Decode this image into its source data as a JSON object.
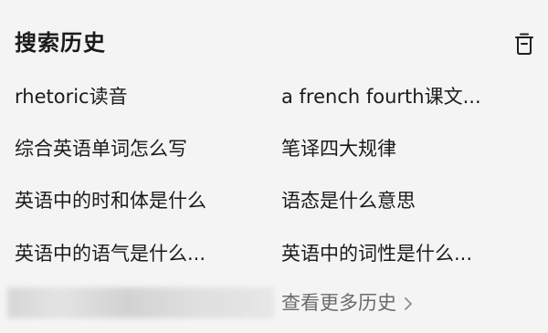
{
  "header": {
    "title": "搜索历史",
    "clear_icon": "trash-icon"
  },
  "history": {
    "items": [
      "rhetoric读音",
      "a french fourth课文...",
      "综合英语单词怎么写",
      "笔译四大规律",
      "英语中的时和体是什么",
      "语态是什么意思",
      "英语中的语气是什么...",
      "英语中的词性是什么..."
    ]
  },
  "more_link": {
    "label": "查看更多历史",
    "icon": "chevron-right-icon"
  },
  "colors": {
    "background": "#f4f4f4",
    "text": "#1b1b1b",
    "muted": "#6b6b6b"
  }
}
